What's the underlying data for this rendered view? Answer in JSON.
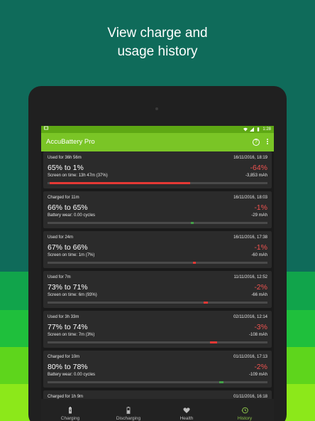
{
  "colors": {
    "bg_top": "#0f6b5a",
    "bg_band1": "#11a44b",
    "bg_band2": "#1fbf3c",
    "bg_band3": "#5ed51c",
    "bg_band4": "#8ce81a",
    "appbar": "#7ac526",
    "statusbar": "#5ea814",
    "discharge_bar": "#e53935",
    "charge_bar": "#43a047",
    "negative_text": "#ef5350",
    "active_tab": "#8bc34a"
  },
  "promo": {
    "line1": "View charge and",
    "line2": "usage history"
  },
  "statusbar": {
    "time": "1:28",
    "left_icon": "notification-icon"
  },
  "app": {
    "title": "AccuBattery Pro",
    "help_icon": "help-icon",
    "more_icon": "more-vert-icon"
  },
  "history": [
    {
      "header": "Used for 36h 56m",
      "date": "16/11/2016, 18:19",
      "range": "65% to 1%",
      "delta": "-64%",
      "detail": "Screen on time: 13h 47m (37%)",
      "mah": "-3,853 mAh",
      "kind": "discharge",
      "bar_start": 0.01,
      "bar_end": 0.65
    },
    {
      "header": "Charged for 11m",
      "date": "16/11/2016, 18:03",
      "range": "66% to 65%",
      "delta": "-1%",
      "detail": "Battery wear: 0.00 cycles",
      "mah": "-29 mAh",
      "kind": "charge",
      "bar_start": 0.65,
      "bar_end": 0.66
    },
    {
      "header": "Used for 24m",
      "date": "16/11/2016, 17:38",
      "range": "67% to 66%",
      "delta": "-1%",
      "detail": "Screen on time: 1m (7%)",
      "mah": "-60 mAh",
      "kind": "discharge",
      "bar_start": 0.66,
      "bar_end": 0.67
    },
    {
      "header": "Used for 7m",
      "date": "11/11/2016, 12:52",
      "range": "73% to 71%",
      "delta": "-2%",
      "detail": "Screen on time: 6m (93%)",
      "mah": "-66 mAh",
      "kind": "discharge",
      "bar_start": 0.71,
      "bar_end": 0.73
    },
    {
      "header": "Used for 3h 33m",
      "date": "02/11/2016, 12:14",
      "range": "77% to 74%",
      "delta": "-3%",
      "detail": "Screen on time: 7m (3%)",
      "mah": "-108 mAh",
      "kind": "discharge",
      "bar_start": 0.74,
      "bar_end": 0.77
    },
    {
      "header": "Charged for 10m",
      "date": "01/11/2016, 17:13",
      "range": "80% to 78%",
      "delta": "-2%",
      "detail": "Battery wear: 0.00 cycles",
      "mah": "-109 mAh",
      "kind": "charge",
      "bar_start": 0.78,
      "bar_end": 0.8
    },
    {
      "header": "Charged for 1h 9m",
      "date": "01/11/2016, 16:18",
      "range": "",
      "delta": "",
      "detail": "",
      "mah": "",
      "kind": "charge",
      "bar_start": 0.8,
      "bar_end": 0.8
    }
  ],
  "nav": [
    {
      "label": "Charging",
      "icon": "battery-charging-icon",
      "active": false
    },
    {
      "label": "Discharging",
      "icon": "battery-discharging-icon",
      "active": false
    },
    {
      "label": "Health",
      "icon": "heart-icon",
      "active": false
    },
    {
      "label": "History",
      "icon": "history-icon",
      "active": true
    }
  ]
}
